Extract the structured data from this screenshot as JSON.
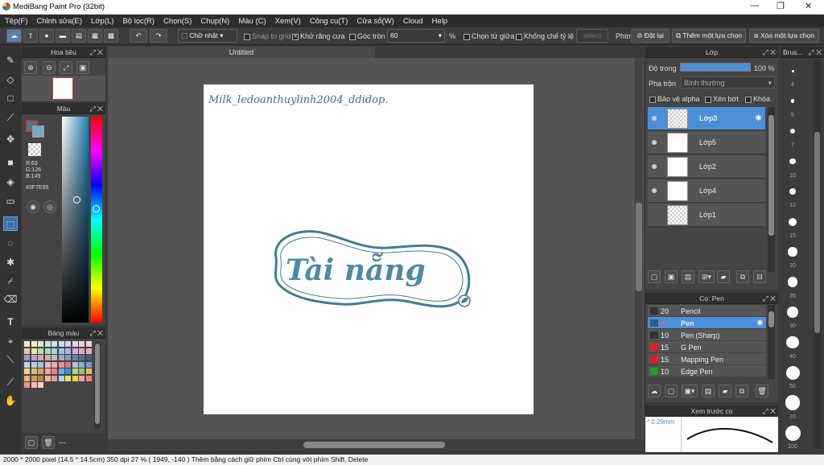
{
  "window": {
    "title": "MediBang Paint Pro (32bit)"
  },
  "menu": [
    "Tệp(F)",
    "Chỉnh sửa(E)",
    "Lớp(L)",
    "Bộ lọc(R)",
    "Chọn(S)",
    "Chụp(N)",
    "Màu (C)",
    "Xem(V)",
    "Công cụ(T)",
    "Cửa sổ(W)",
    "Cloud",
    "Help"
  ],
  "toolbar": {
    "shape": "Chữ nhật",
    "snap": "Snap to grid",
    "antialias": "Khử răng cưa",
    "corner": "Góc tròn",
    "corner_value": "60",
    "pct": "%",
    "center": "Chọn từ giữa",
    "ratio": "Khống chế tỷ lệ",
    "ratio_field": "select",
    "shortcut_label": "Phím",
    "reset": "Đặt lại",
    "add_sel": "Thêm một lựa chọn",
    "del_sel": "Xóa một lựa chọn"
  },
  "navigator": {
    "title": "Hoa tiêu"
  },
  "color": {
    "title": "Màu",
    "r": "R:63",
    "g": "G:126",
    "b": "B:149",
    "hex": "#3F7E95",
    "main": "#3F7E95"
  },
  "palette": {
    "title": "Bảng màu",
    "footer": "---",
    "colors": [
      "#f6e6c9",
      "#eef0c4",
      "#d8ecc8",
      "#cde8d8",
      "#c6e6e6",
      "#c9dcef",
      "#d2d2ee",
      "#e4d0ec",
      "#f0cfe0",
      "#f4d0d0",
      "#f1c6a2",
      "#e8ea9e",
      "#b9e0a2",
      "#a5d8be",
      "#a1d8d8",
      "#a3c3e6",
      "#b2b2e4",
      "#cfaee0",
      "#e6aac8",
      "#eeaeae",
      "#9b9bc9",
      "#b0a2c6",
      "#c9a2c2",
      "#d8a6b0",
      "#bdbdbd",
      "#9fa7c4",
      "#8596b8",
      "#6e7fa6",
      "#5a6a92",
      "#48587e",
      "#c4d6ea",
      "#b9cfe6",
      "#a7c3e0",
      "#e2c1c1",
      "#ecaaaa",
      "#e09595",
      "#cc8080",
      "#aac0dc",
      "#91b0d4",
      "#7a9fcb",
      "#f3d39d",
      "#e4b97a",
      "#d4a060",
      "#f2a1a1",
      "#e68282",
      "#6db3e0",
      "#3d92cf",
      "#b5d68a",
      "#96c46e",
      "#e0c050",
      "#e8b478",
      "#d89860",
      "#c07e48",
      "#f5b49d",
      "#ed9c84",
      "#a8d0f0",
      "#e8e070",
      "#f0d040",
      "#f5a0a0",
      "#f08080",
      "#f09090",
      "#f8b8b8",
      "#f8d0c8"
    ]
  },
  "canvas": {
    "tab": "Untitled",
    "doc_text": "Milk_ledoanthuylinh2004_ddidop.",
    "art_text": "Tài nẵng"
  },
  "layers": {
    "title": "Lớp",
    "opacity_label": "Độ trong",
    "opacity_value": "100 %",
    "blend_label": "Pha trộn",
    "blend_value": "Bình thường",
    "protect_alpha": "Bảo vệ alpha",
    "clip": "Xén bớt",
    "lock": "Khóa",
    "items": [
      {
        "name": "Lớp3",
        "selected": true
      },
      {
        "name": "Lớp5",
        "selected": false
      },
      {
        "name": "Lớp2",
        "selected": false
      },
      {
        "name": "Lớp4",
        "selected": false
      },
      {
        "name": "Lớp1",
        "selected": false
      }
    ]
  },
  "brushes": {
    "title": "Cọ: Pen",
    "items": [
      {
        "size": "20",
        "name": "Pencil",
        "color": "#333333"
      },
      {
        "size": "4",
        "name": "Pen",
        "color": "#2b5f80",
        "selected": true
      },
      {
        "size": "10",
        "name": "Pen (Sharp)",
        "color": "#333333"
      },
      {
        "size": "15",
        "name": "G Pen",
        "color": "#e02020"
      },
      {
        "size": "15",
        "name": "Mapping Pen",
        "color": "#e02020"
      },
      {
        "size": "10",
        "name": "Edge Pen",
        "color": "#20a020"
      }
    ]
  },
  "preview": {
    "title": "Xem trước cọ",
    "size": "* 0.29mm"
  },
  "brush_sizes": {
    "title": "Brus...",
    "values": [
      "4",
      "5",
      "7",
      "10",
      "12",
      "15",
      "20",
      "25",
      "30",
      "40",
      "50",
      "70",
      "100"
    ]
  },
  "status": {
    "text": "2000 * 2000 pixel  (14.5 * 14.5cm)  350 dpi  27 %  ( 1949, -140 )  Thêm bằng cách giữ phím Ctrl cùng với phím Shift, Delete"
  }
}
